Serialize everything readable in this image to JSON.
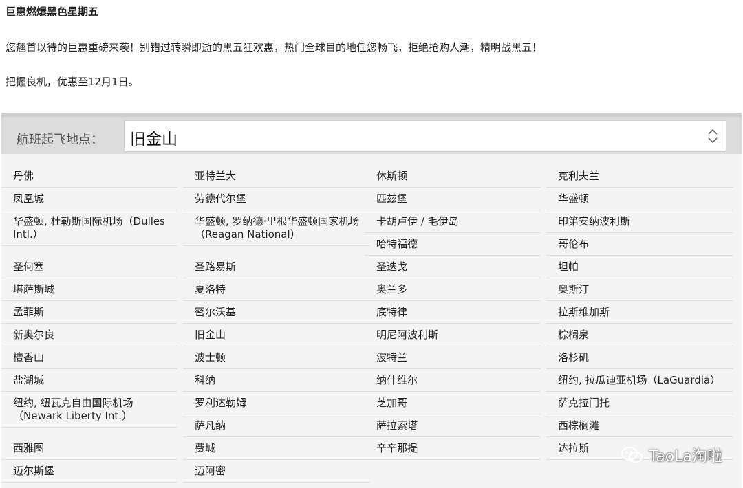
{
  "intro": {
    "title": "巨惠燃爆黑色星期五",
    "paragraph1": "您翘首以待的巨惠重磅来袭！别错过转瞬即逝的黑五狂欢惠，热门全球目的地任您畅飞，拒绝抢购人潮，精明战黑五！",
    "paragraph2": "把握良机，优惠至12月1日。"
  },
  "origin": {
    "label": "航班起飞地点：",
    "selected": "旧金山"
  },
  "cities": {
    "col1": [
      "丹佛",
      "凤凰城",
      "华盛顿, 杜勒斯国际机场（Dulles Intl.）",
      "圣何塞",
      "堪萨斯城",
      "孟菲斯",
      "新奥尔良",
      "檀香山",
      "盐湖城",
      "纽约, 纽瓦克自由国际机场（Newark Liberty Int.）",
      "西雅图",
      "迈尔斯堡"
    ],
    "col2": [
      "亚特兰大",
      "劳德代尔堡",
      "华盛顿, 罗纳德·里根华盛顿国家机场（Reagan National）",
      "圣路易斯",
      "夏洛特",
      "密尔沃基",
      "旧金山",
      "波士顿",
      "科纳",
      "罗利达勒姆",
      "萨凡纳",
      "费城",
      "迈阿密"
    ],
    "col3": [
      "休斯顿",
      "匹兹堡",
      "卡胡卢伊 / 毛伊岛",
      "哈特福德",
      "圣迭戈",
      "奥兰多",
      "底特律",
      "明尼阿波利斯",
      "波特兰",
      "纳什维尔",
      "芝加哥",
      "萨拉索塔",
      "辛辛那提"
    ],
    "col4": [
      "克利夫兰",
      "华盛顿",
      "印第安纳波利斯",
      "哥伦布",
      "坦帕",
      "奥斯汀",
      "拉斯维加斯",
      "棕榈泉",
      "洛杉矶",
      "纽约, 拉瓜迪亚机场（LaGuardia）",
      "萨克拉门托",
      "西棕榈滩",
      "达拉斯"
    ]
  },
  "watermark": "TaoLa淘啦",
  "icons": {
    "select": "chevron-updown-icon",
    "watermark": "wechat-icon"
  }
}
